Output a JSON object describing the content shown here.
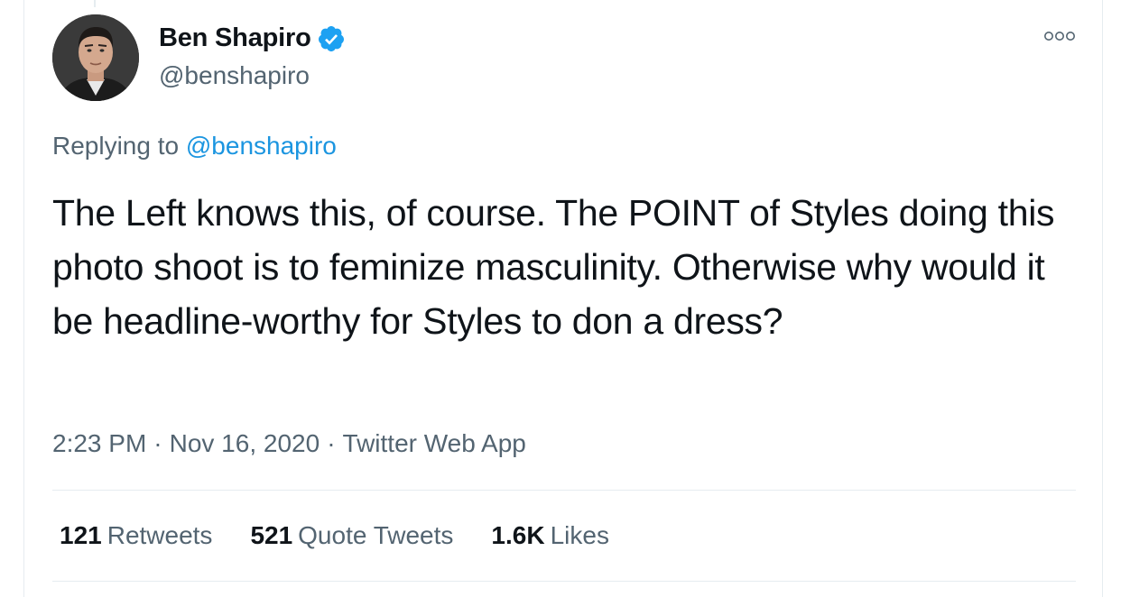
{
  "author": {
    "display_name": "Ben Shapiro",
    "handle": "@benshapiro",
    "verified": true
  },
  "icons": {
    "verified": "verified-badge-icon",
    "more": "more-options-icon"
  },
  "reply": {
    "prefix": "Replying to ",
    "to_handle": "@benshapiro"
  },
  "tweet": {
    "text": "The Left knows this, of course. The POINT of Styles doing this photo shoot is to feminize masculinity. Otherwise why would it be headline-worthy for Styles to don a dress?",
    "time": "2:23 PM",
    "date": "Nov 16, 2020",
    "source": "Twitter Web App",
    "separator": "·"
  },
  "stats": {
    "retweets_count": "121",
    "retweets_label": "Retweets",
    "quotes_count": "521",
    "quotes_label": "Quote Tweets",
    "likes_count": "1.6K",
    "likes_label": "Likes"
  },
  "colors": {
    "text_primary": "#0f1419",
    "text_secondary": "#536471",
    "link": "#1b95e0",
    "verified": "#1da1f2",
    "border": "#e6ecf0"
  }
}
